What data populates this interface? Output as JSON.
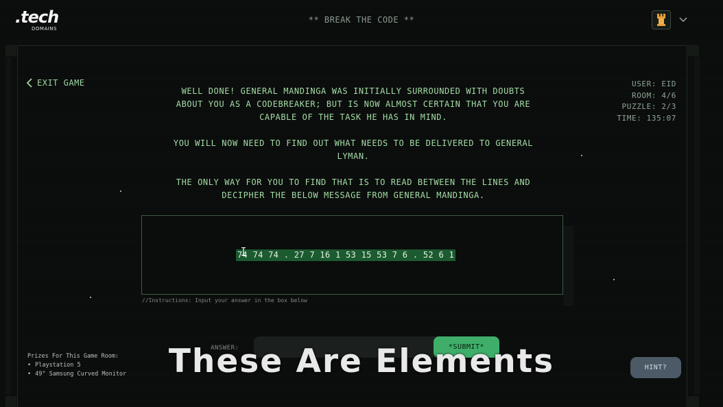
{
  "header": {
    "logo_main": ".tech",
    "logo_sub": "DOMAINS",
    "title": "** BREAK THE CODE **"
  },
  "nav": {
    "exit_label": "EXIT GAME"
  },
  "status": {
    "user": "USER: EID",
    "room": "ROOM: 4/6",
    "puzzle": "PUZZLE: 2/3",
    "time": "TIME: 135:07"
  },
  "story": {
    "p1_l1": "WELL DONE! GENERAL MANDINGA WAS INITIALLY SURROUNDED WITH DOUBTS",
    "p1_l2": "ABOUT YOU AS A CODEBREAKER; BUT IS NOW ALMOST CERTAIN THAT YOU ARE",
    "p1_l3": "CAPABLE OF THE TASK HE HAS IN MIND.",
    "p2_l1": "YOU WILL NOW NEED TO FIND OUT WHAT NEEDS TO BE DELIVERED TO GENERAL",
    "p2_l2": "LYMAN.",
    "p3_l1": "THE ONLY WAY FOR YOU TO FIND THAT IS TO READ BETWEEN THE LINES AND",
    "p3_l2": "DECIPHER THE BELOW MESSAGE FROM GENERAL MANDINGA."
  },
  "puzzle": {
    "code": "74 74 74 . 27 7 16 1 53 15 53 7 6 . 52 6 1",
    "instructions": "//Instructions: Input your answer in the box below"
  },
  "answer": {
    "label": "ANSWER:",
    "value": "",
    "submit_label": "*SUBMIT*"
  },
  "prizes": {
    "title": "Prizes For This Game Room:",
    "items": [
      "Playstation 5",
      "49\" Samsung Curved Monitor"
    ]
  },
  "hint": {
    "label": "HINT?"
  },
  "overlay": {
    "caption": "These Are Elements"
  },
  "colors": {
    "accent_green": "#3fae6a",
    "text_green": "#9fd8a2",
    "highlight": "#1c5a30",
    "hint_bg": "#4b5a66"
  },
  "icons": {
    "exit": "chevron-left-icon",
    "tower": "tower-icon",
    "menu": "chevron-down-icon",
    "cursor": "text-cursor-icon"
  }
}
